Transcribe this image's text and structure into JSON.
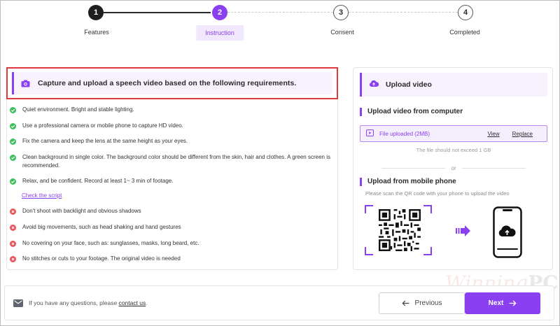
{
  "stepper": {
    "steps": [
      {
        "number": "1",
        "label": "Features",
        "state": "done"
      },
      {
        "number": "2",
        "label": "Instruction",
        "state": "active"
      },
      {
        "number": "3",
        "label": "Consent",
        "state": "pending"
      },
      {
        "number": "4",
        "label": "Completed",
        "state": "pending"
      }
    ]
  },
  "requirements": {
    "title": "Capture and upload a speech video based on the following requirements.",
    "items": [
      {
        "type": "ok",
        "text": "Quiet environment. Bright and stable lighting."
      },
      {
        "type": "ok",
        "text": "Use a professional camera or mobile phone to capture HD video."
      },
      {
        "type": "ok",
        "text": "Fix the camera and keep the lens at the same height as your eyes."
      },
      {
        "type": "ok",
        "text": "Clean background in single color. The background color should be different from the skin, hair and clothes. A green screen is recommended."
      },
      {
        "type": "ok",
        "text": "Relax, and be confident. Record at least 1~ 3 min of footage."
      },
      {
        "type": "no",
        "text": "Don't shoot with backlight and obvious shadows"
      },
      {
        "type": "no",
        "text": "Avoid big movements, such as head shaking and hand gestures"
      },
      {
        "type": "no",
        "text": "No covering on your face, such as: sunglasses, masks, long beard, etc."
      },
      {
        "type": "no",
        "text": "No stitches or cuts to your footage. The original video is needed"
      }
    ],
    "script_link": "Check the script"
  },
  "upload": {
    "title": "Upload video",
    "computer_section": "Upload video from computer",
    "file_status": "File uploaded (2MB)",
    "view_label": "View",
    "replace_label": "Replace",
    "limit_note": "The file should not exceed 1 GB",
    "or_label": "or",
    "mobile_section": "Upload from mobile phone",
    "scan_note": "Please scan the QR code with your phone to upload the video"
  },
  "footer": {
    "help_prefix": "If you have any questions, please ",
    "contact_label": "contact us",
    "help_suffix": ".",
    "prev_label": "Previous",
    "next_label": "Next"
  },
  "watermark": {
    "text": "Winning",
    "suffix": "PC"
  },
  "colors": {
    "accent": "#8a3ff0",
    "success": "#3dbf5b",
    "error": "#e8545a",
    "highlight_border": "#e0393b"
  }
}
